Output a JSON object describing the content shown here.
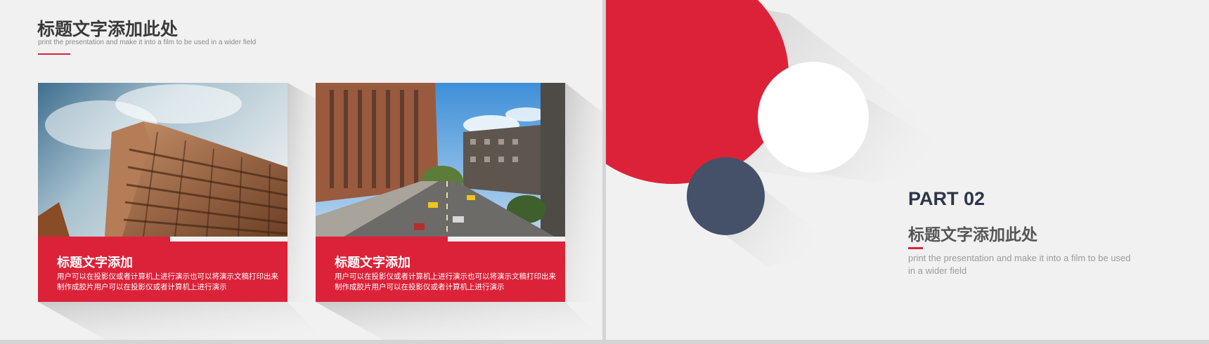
{
  "left_slide": {
    "title": "标题文字添加此处",
    "subtitle": "print the presentation and make it into a film to be used in a wider field",
    "cards": [
      {
        "title": "标题文字添加",
        "body": "用户可以在投影仪或者计算机上进行演示也可以将演示文稿打印出来制作成胶片用户可以在投影仪或者计算机上进行演示",
        "photo_icon": "building-photo-icon"
      },
      {
        "title": "标题文字添加",
        "body": "用户可以在投影仪或者计算机上进行演示也可以将演示文稿打印出来制作成胶片用户可以在投影仪或者计算机上进行演示",
        "photo_icon": "city-street-photo-icon"
      }
    ]
  },
  "right_slide": {
    "part_label": "PART 02",
    "title": "标题文字添加此处",
    "subtitle": "print the presentation and make it into a film to be used in a wider field"
  },
  "colors": {
    "accent_red": "#dc2239",
    "navy": "#445168",
    "dark_text": "#3a3a3a",
    "background": "#f1f1f1"
  }
}
